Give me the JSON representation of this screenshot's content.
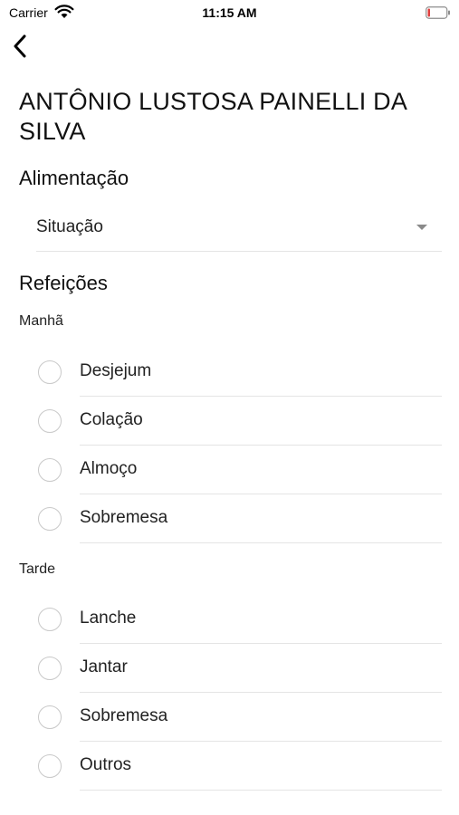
{
  "status_bar": {
    "carrier": "Carrier",
    "time": "11:15 AM",
    "battery_color": "#e0403f"
  },
  "nav": {
    "back_icon": "chevron-left-icon"
  },
  "header": {
    "title": "ANTÔNIO LUSTOSA PAINELLI DA SILVA"
  },
  "alimentacao": {
    "title": "Alimentação",
    "dropdown": {
      "value": "Situação"
    }
  },
  "refeicoes": {
    "title": "Refeições",
    "groups": [
      {
        "label": "Manhã",
        "options": [
          {
            "label": "Desjejum",
            "selected": false
          },
          {
            "label": "Colação",
            "selected": false
          },
          {
            "label": "Almoço",
            "selected": false
          },
          {
            "label": "Sobremesa",
            "selected": false
          }
        ]
      },
      {
        "label": "Tarde",
        "options": [
          {
            "label": "Lanche",
            "selected": false
          },
          {
            "label": "Jantar",
            "selected": false
          },
          {
            "label": "Sobremesa",
            "selected": false
          },
          {
            "label": "Outros",
            "selected": false
          }
        ]
      }
    ]
  },
  "next_section": {
    "title": ""
  }
}
